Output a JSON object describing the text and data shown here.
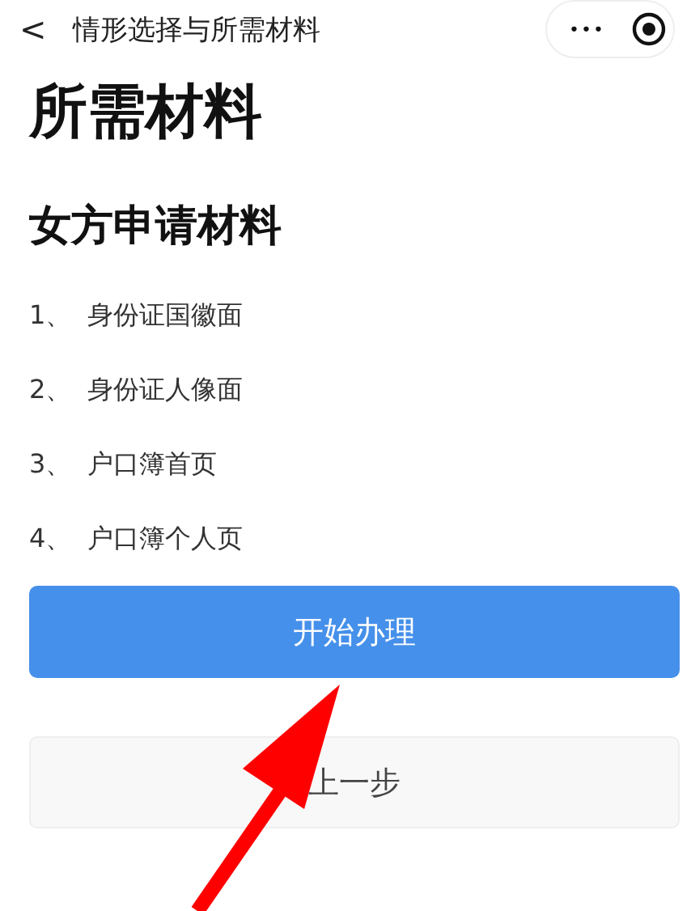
{
  "nav_bar": {
    "back": "<",
    "title": "情形选择与所需材料",
    "more": "•••"
  },
  "page_title": "所需材料",
  "section_title": "女方申请材料",
  "materials": [
    {
      "number": "1、",
      "label": "身份证国徽面"
    },
    {
      "number": "2、",
      "label": "身份证人像面"
    },
    {
      "number": "3、",
      "label": "户口簿首页"
    },
    {
      "number": "4、",
      "label": "户口簿个人页"
    }
  ],
  "buttons": [
    {
      "kind": "primary",
      "label": "开始办理"
    },
    {
      "kind": "secondary",
      "label": "上一步"
    }
  ],
  "annotation": {
    "kind": "arrow"
  }
}
